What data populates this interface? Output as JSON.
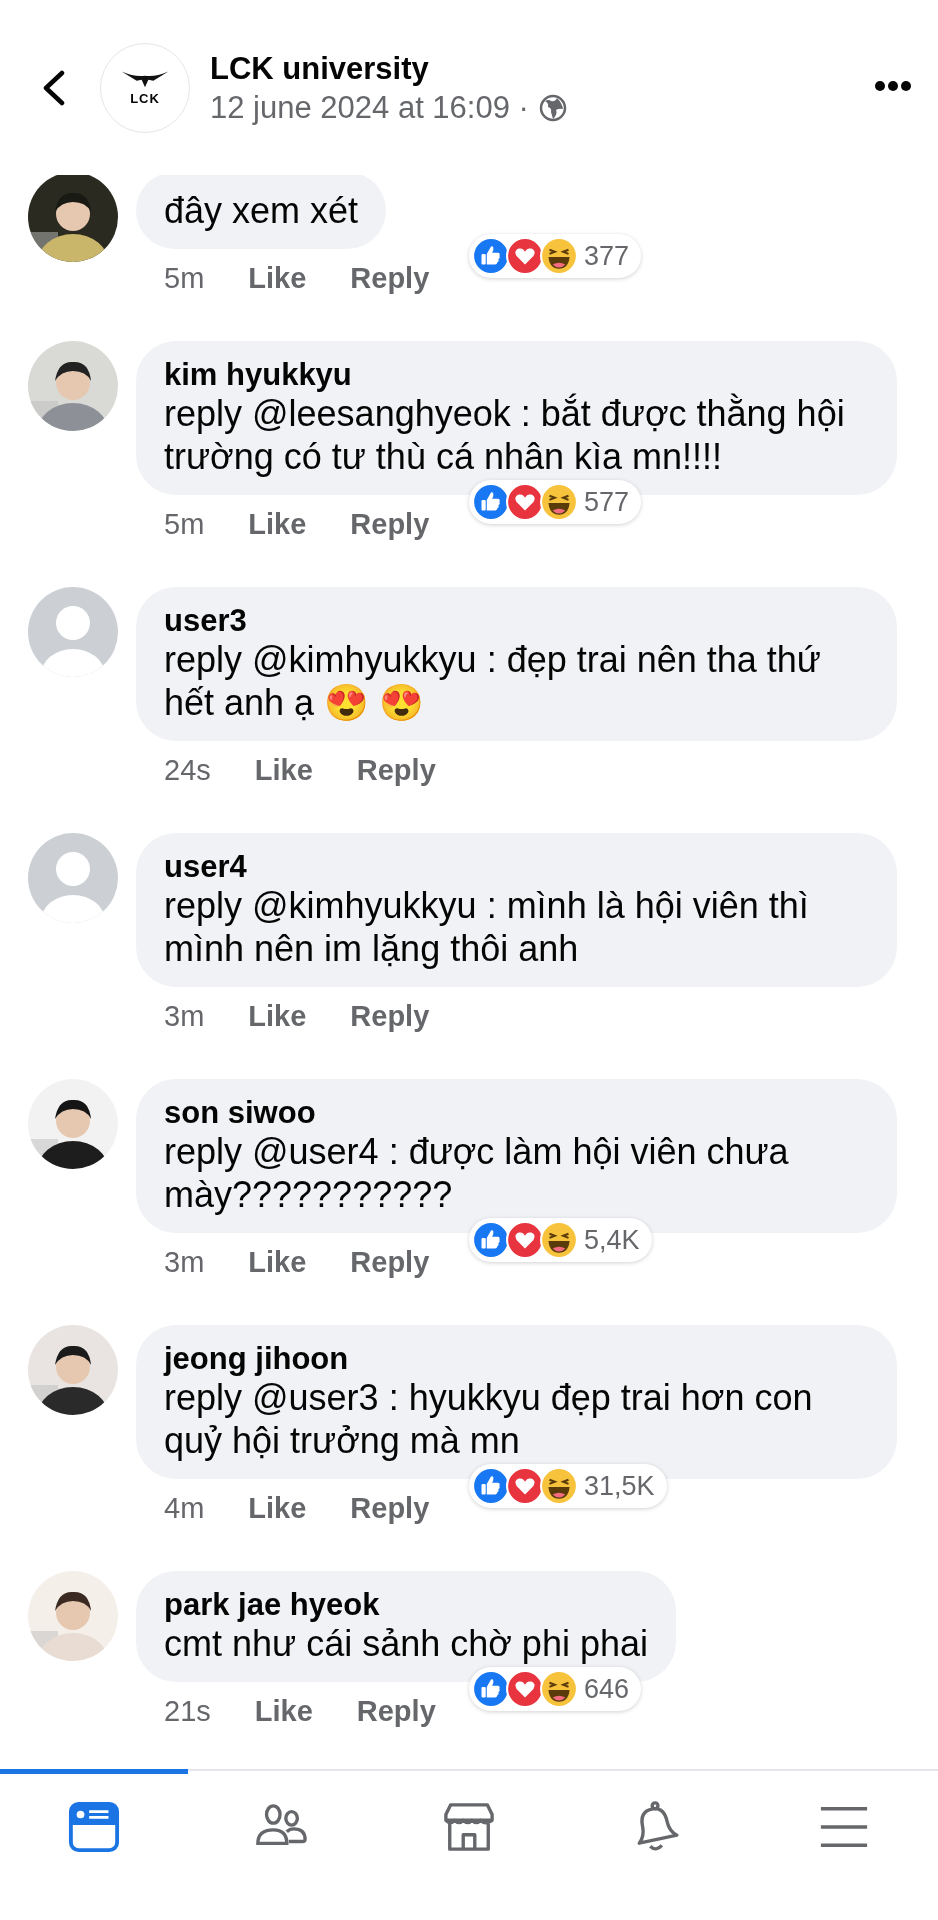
{
  "header": {
    "logo_text": "LCK",
    "title": "LCK university",
    "time": "12 june 2024 at 16:09 ·"
  },
  "comments": [
    {
      "text": "đây xem xét",
      "time": "5m",
      "like": "Like",
      "reply": "Reply",
      "reactions": "377"
    },
    {
      "name": "kim hyukkyu",
      "text": "reply @leesanghyeok : bắt được thằng hội trường có tư thù cá nhân kìa mn!!!!",
      "time": "5m",
      "like": "Like",
      "reply": "Reply",
      "reactions": "577"
    },
    {
      "kind": "default",
      "name": "user3",
      "text": "reply @kimhyukkyu : đẹp trai nên tha thứ hết anh ạ 😍 😍",
      "time": "24s",
      "like": "Like",
      "reply": "Reply"
    },
    {
      "kind": "default",
      "name": "user4",
      "text": "reply @kimhyukkyu : mình là hội viên thì mình nên im lặng thôi anh",
      "time": "3m",
      "like": "Like",
      "reply": "Reply"
    },
    {
      "name": "son siwoo",
      "text": "reply @user4 : được làm hội viên chưa mày???????????",
      "time": "3m",
      "like": "Like",
      "reply": "Reply",
      "reactions": "5,4K"
    },
    {
      "name": "jeong jihoon",
      "text": "reply @user3 : hyukkyu đẹp trai hơn con quỷ hội trưởng mà mn",
      "time": "4m",
      "like": "Like",
      "reply": "Reply",
      "reactions": "31,5K"
    },
    {
      "name": "park jae hyeok",
      "text": "cmt như cái sảnh chờ phi phai",
      "time": "21s",
      "like": "Like",
      "reply": "Reply",
      "reactions": "646"
    }
  ],
  "nav": [
    {
      "kind": "feed",
      "selected": true
    },
    {
      "kind": "friends",
      "selected": false
    },
    {
      "kind": "marketplace",
      "selected": false
    },
    {
      "kind": "notifications",
      "selected": false
    },
    {
      "kind": "menu",
      "selected": false
    }
  ]
}
